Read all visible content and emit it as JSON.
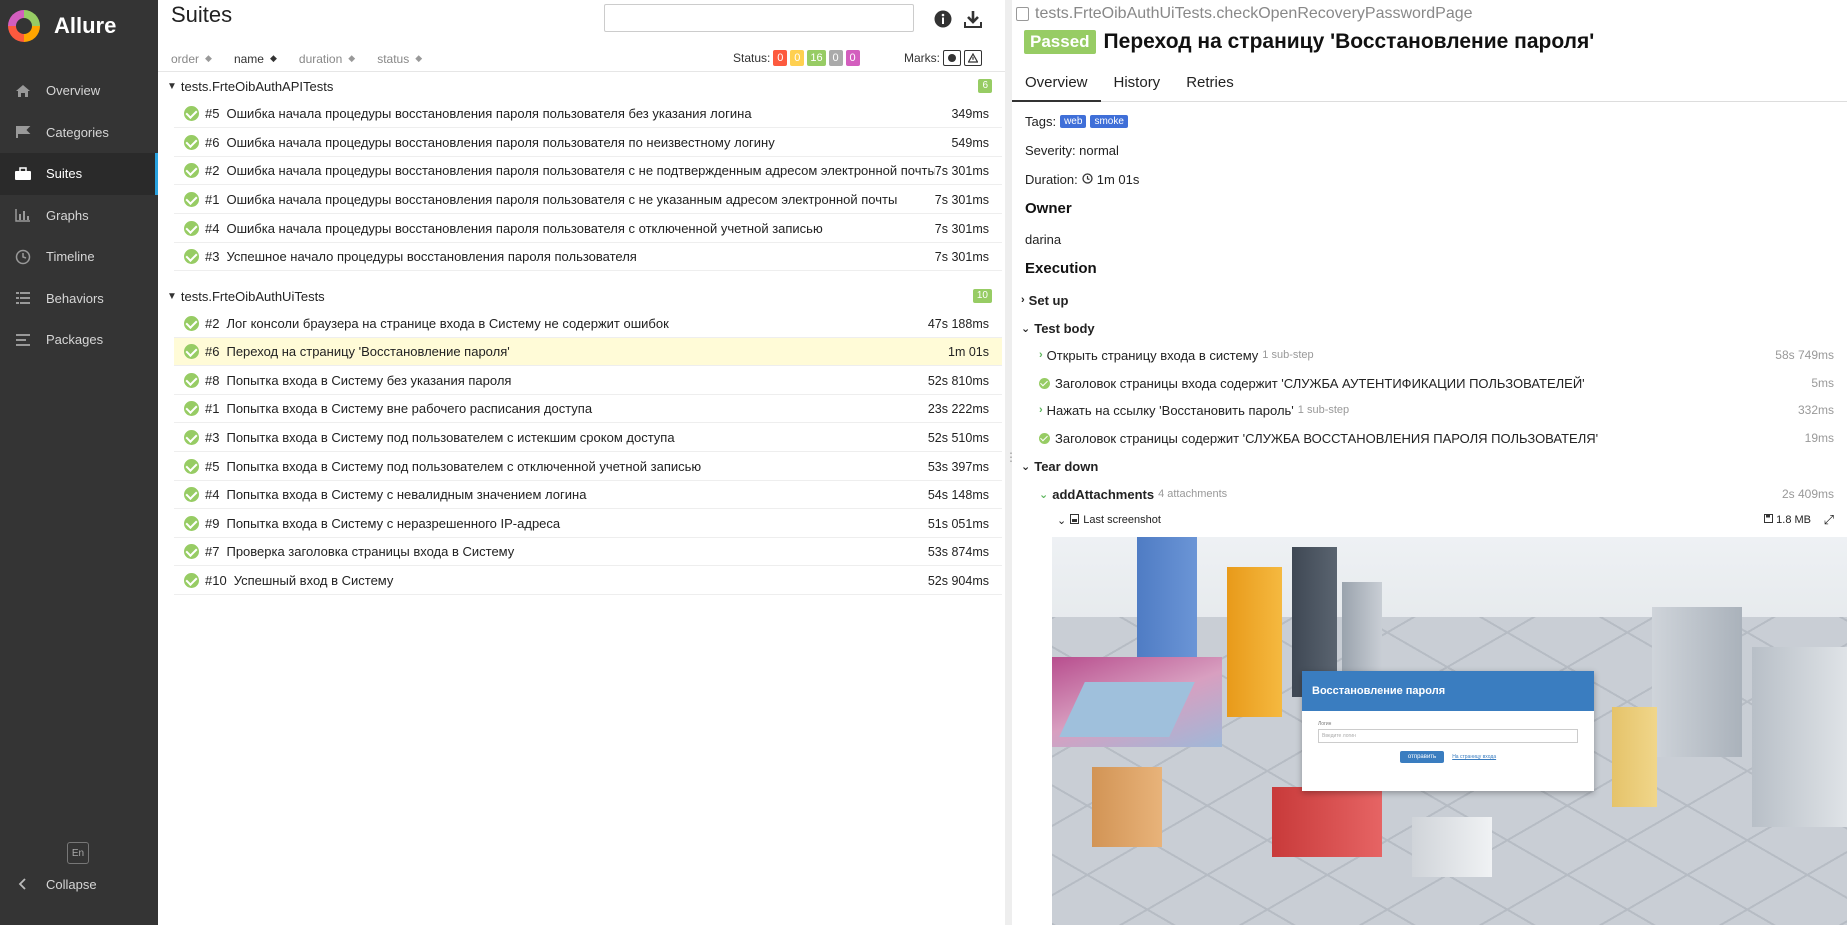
{
  "app": {
    "name": "Allure"
  },
  "sidebar": {
    "items": [
      {
        "label": "Overview",
        "icon": "home-icon"
      },
      {
        "label": "Categories",
        "icon": "flag-icon"
      },
      {
        "label": "Suites",
        "icon": "briefcase-icon"
      },
      {
        "label": "Graphs",
        "icon": "bar-chart-icon"
      },
      {
        "label": "Timeline",
        "icon": "clock-icon"
      },
      {
        "label": "Behaviors",
        "icon": "list-icon"
      },
      {
        "label": "Packages",
        "icon": "align-left-icon"
      }
    ],
    "active": "Suites",
    "lang": "En",
    "collapse_label": "Collapse"
  },
  "suites": {
    "title": "Suites",
    "search_value": "",
    "sort": {
      "order": "order",
      "name": "name",
      "duration": "duration",
      "status": "status"
    },
    "status_label": "Status:",
    "status_counts": [
      {
        "value": "0",
        "color": "#fd5a3e"
      },
      {
        "value": "0",
        "color": "#ffd050"
      },
      {
        "value": "16",
        "color": "#97cc64"
      },
      {
        "value": "0",
        "color": "#aaaaaa"
      },
      {
        "value": "0",
        "color": "#d35ebe"
      }
    ],
    "marks_label": "Marks:",
    "groups": [
      {
        "name": "tests.FrteOibAuthAPITests",
        "count": "6",
        "rows": [
          {
            "num": "#5",
            "name": "Ошибка начала процедуры восстановления пароля пользователя без указания логина",
            "dur": "349ms"
          },
          {
            "num": "#6",
            "name": "Ошибка начала процедуры восстановления пароля пользователя по неизвестному логину",
            "dur": "549ms"
          },
          {
            "num": "#2",
            "name": "Ошибка начала процедуры восстановления пароля пользователя с не подтвержденным адресом электронной почты",
            "dur": "7s 301ms"
          },
          {
            "num": "#1",
            "name": "Ошибка начала процедуры восстановления пароля пользователя с не указанным адресом электронной почты",
            "dur": "7s 301ms"
          },
          {
            "num": "#4",
            "name": "Ошибка начала процедуры восстановления пароля пользователя с отключенной учетной записью",
            "dur": "7s 301ms"
          },
          {
            "num": "#3",
            "name": "Успешное начало процедуры восстановления пароля пользователя",
            "dur": "7s 301ms"
          }
        ]
      },
      {
        "name": "tests.FrteOibAuthUiTests",
        "count": "10",
        "rows": [
          {
            "num": "#2",
            "name": "Лог консоли браузера на странице входа в Систему не содержит ошибок",
            "dur": "47s 188ms"
          },
          {
            "num": "#6",
            "name": "Переход на страницу 'Восстановление пароля'",
            "dur": "1m 01s"
          },
          {
            "num": "#8",
            "name": "Попытка входа в Систему без указания пароля",
            "dur": "52s 810ms"
          },
          {
            "num": "#1",
            "name": "Попытка входа в Систему вне рабочего расписания доступа",
            "dur": "23s 222ms"
          },
          {
            "num": "#3",
            "name": "Попытка входа в Систему под пользователем с истекшим сроком доступа",
            "dur": "52s 510ms"
          },
          {
            "num": "#5",
            "name": "Попытка входа в Систему под пользователем с отключенной учетной записью",
            "dur": "53s 397ms"
          },
          {
            "num": "#4",
            "name": "Попытка входа в Систему с невалидным значением логина",
            "dur": "54s 148ms"
          },
          {
            "num": "#9",
            "name": "Попытка входа в Систему с неразрешенного IP-адреса",
            "dur": "51s 051ms"
          },
          {
            "num": "#7",
            "name": "Проверка заголовка страницы входа в Систему",
            "dur": "53s 874ms"
          },
          {
            "num": "#10",
            "name": "Успешный вход в Систему",
            "dur": "52s 904ms"
          }
        ]
      }
    ]
  },
  "detail": {
    "full_name": "tests.FrteOibAuthUiTests.checkOpenRecoveryPasswordPage",
    "status": "Passed",
    "title": "Переход на страницу 'Восстановление пароля'",
    "tabs": [
      "Overview",
      "History",
      "Retries"
    ],
    "tags_label": "Tags:",
    "tags": [
      "web",
      "smoke"
    ],
    "severity": "Severity: normal",
    "duration_label": "Duration:",
    "duration": "1m 01s",
    "owner_h": "Owner",
    "owner": "darina",
    "execution_h": "Execution",
    "setup": "Set up",
    "test_body": "Test body",
    "steps": [
      {
        "name": "Открыть страницу входа в систему",
        "sub": "1 sub-step",
        "dur": "58s 749ms",
        "kind": "expand"
      },
      {
        "name": "Заголовок страницы входа содержит 'СЛУЖБА АУТЕНТИФИКАЦИИ ПОЛЬЗОВАТЕЛЕЙ'",
        "sub": "",
        "dur": "5ms",
        "kind": "ok"
      },
      {
        "name": "Нажать на ссылку 'Восстановить пароль'",
        "sub": "1 sub-step",
        "dur": "332ms",
        "kind": "expand"
      },
      {
        "name": "Заголовок страницы содержит 'СЛУЖБА ВОССТАНОВЛЕНИЯ ПАРОЛЯ ПОЛЬЗОВАТЕЛЯ'",
        "sub": "",
        "dur": "19ms",
        "kind": "ok"
      }
    ],
    "teardown": "Tear down",
    "add_attachments": {
      "name": "addAttachments",
      "sub": "4 attachments",
      "dur": "2s 409ms"
    },
    "attachment": {
      "name": "Last screenshot",
      "size": "1.8 MB"
    },
    "screenshot": {
      "modal_title": "Восстановление пароля",
      "field_label": "Логин",
      "placeholder": "Введите логин",
      "button": "отправить",
      "link": "На страницу входа"
    }
  }
}
